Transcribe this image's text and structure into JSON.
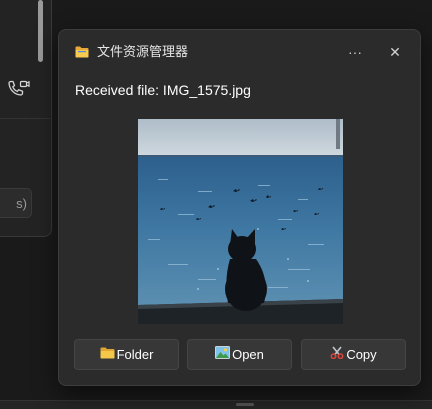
{
  "background_window": {
    "input_text": "s)"
  },
  "notification": {
    "app_name": "文件资源管理器",
    "more_glyph": "···",
    "close_glyph": "✕",
    "message": "Received file: IMG_1575.jpg",
    "image_alt": "Photo of a black cat sitting on a wall looking out at the sea with birds",
    "actions": [
      {
        "label": "Folder",
        "icon": "folder-icon"
      },
      {
        "label": "Open",
        "icon": "picture-icon"
      },
      {
        "label": "Copy",
        "icon": "scissors-icon"
      }
    ]
  },
  "colors": {
    "card_bg": "#2b2b2b",
    "button_bg": "#373737",
    "folder_yellow": "#f3c447",
    "scissors_red": "#d9443a"
  }
}
